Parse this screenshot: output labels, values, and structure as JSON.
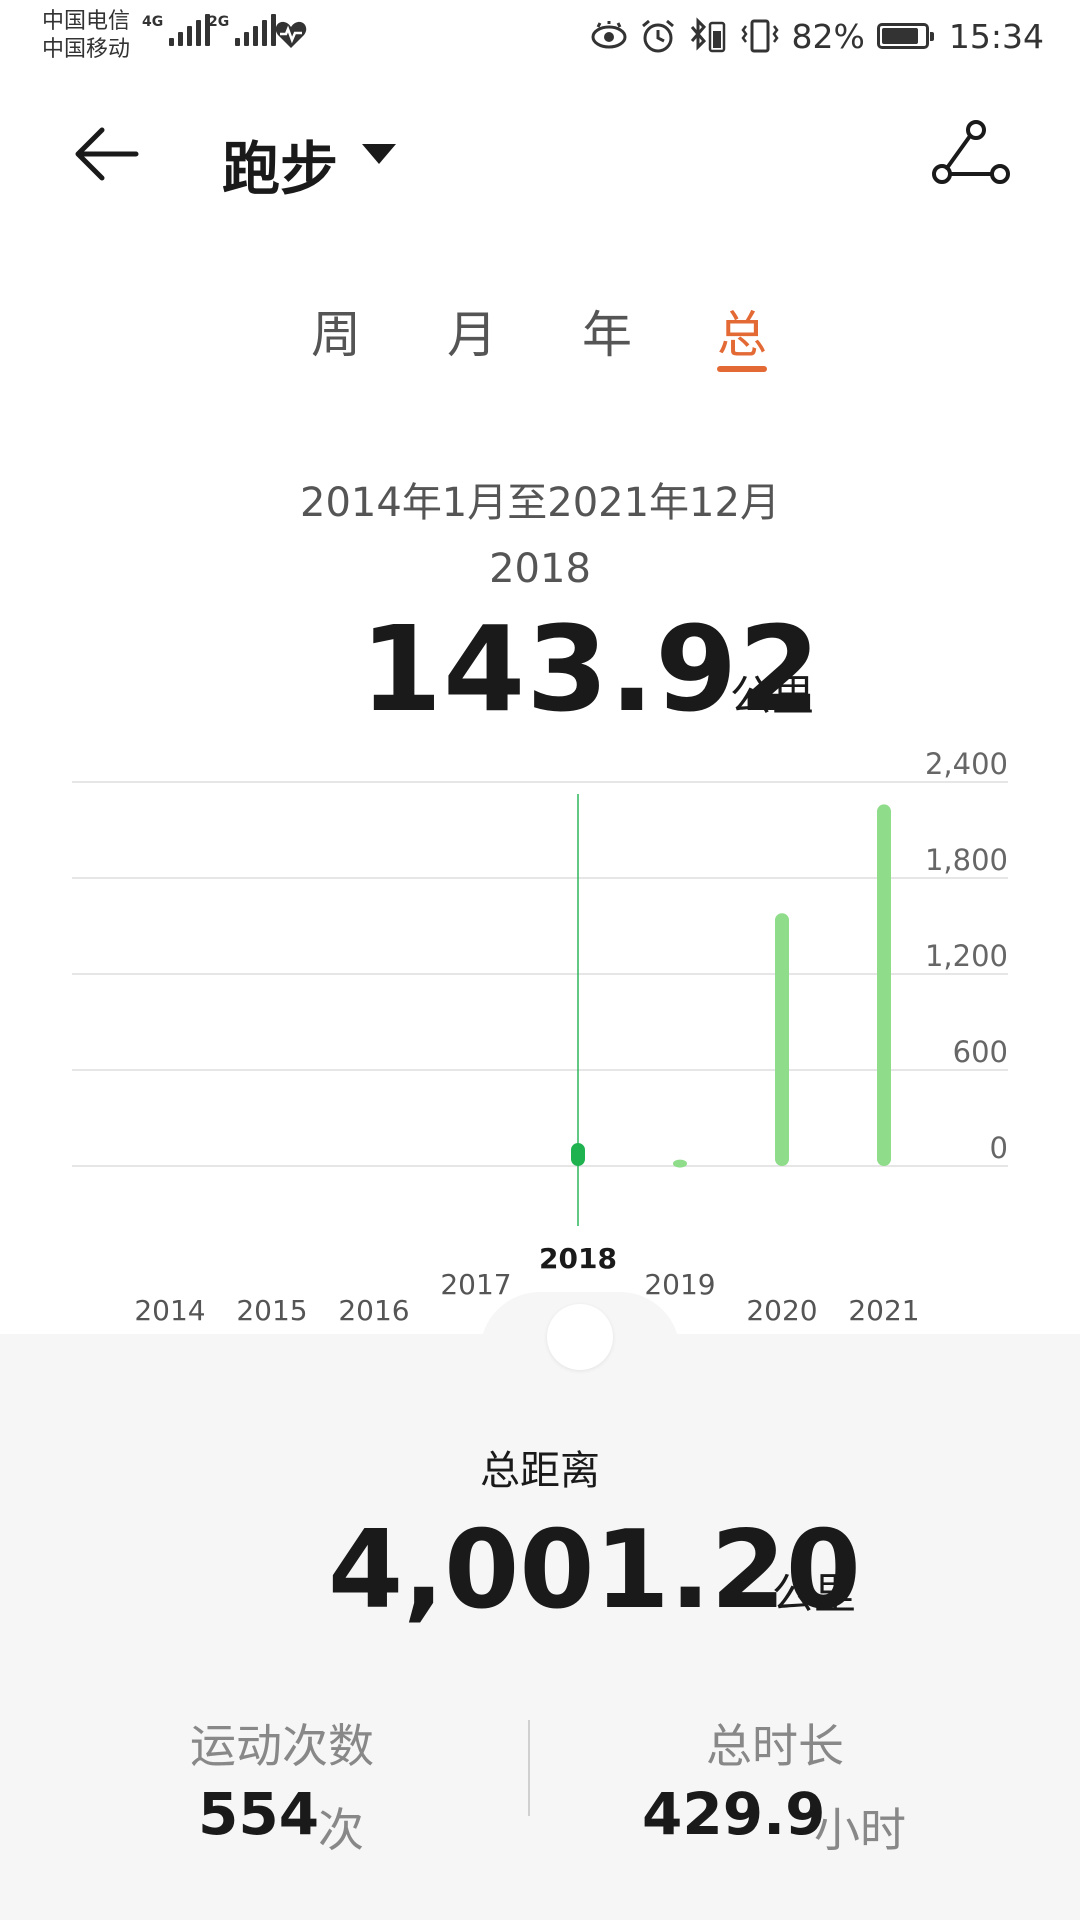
{
  "status_bar": {
    "carrier_1": "中国电信",
    "carrier_2": "中国移动",
    "net_1": "4G",
    "net_2": "2G",
    "battery": "82%",
    "battery_level": 0.82,
    "time": "15:34"
  },
  "header": {
    "title": "跑步",
    "back_icon": "arrow-left-icon",
    "route_icon": "route-icon"
  },
  "tabs": [
    {
      "label": "周"
    },
    {
      "label": "月"
    },
    {
      "label": "年"
    },
    {
      "label": "总"
    }
  ],
  "active_tab": 3,
  "summary": {
    "range": "2014年1月至2021年12月",
    "selected_year": "2018",
    "value": "143.92",
    "unit": "公里"
  },
  "chart_data": {
    "type": "bar",
    "categories": [
      "2014",
      "2015",
      "2016",
      "2017",
      "2018",
      "2019",
      "2020",
      "2021"
    ],
    "values": [
      0,
      0,
      0,
      0,
      143.92,
      40,
      1580,
      2260
    ],
    "selected": "2018",
    "y_ticks": [
      "2,400",
      "1,800",
      "1,200",
      "600",
      "0"
    ],
    "ylim": [
      0,
      2400
    ],
    "grid": true,
    "colors": {
      "bar": "#8fdc8a",
      "selected": "#1fb350",
      "grid": "#e6e6e6",
      "axis_text": "#666666"
    }
  },
  "totals": {
    "distance_label": "总距离",
    "distance_value": "4,001.20",
    "distance_unit": "公里",
    "count_label": "运动次数",
    "count_value": "554",
    "count_unit": "次",
    "duration_label": "总时长",
    "duration_value": "429.9",
    "duration_unit": "小时"
  },
  "colors": {
    "accent": "#e36a35",
    "bar": "#8fdc8a",
    "bar_selected": "#1fb350"
  }
}
